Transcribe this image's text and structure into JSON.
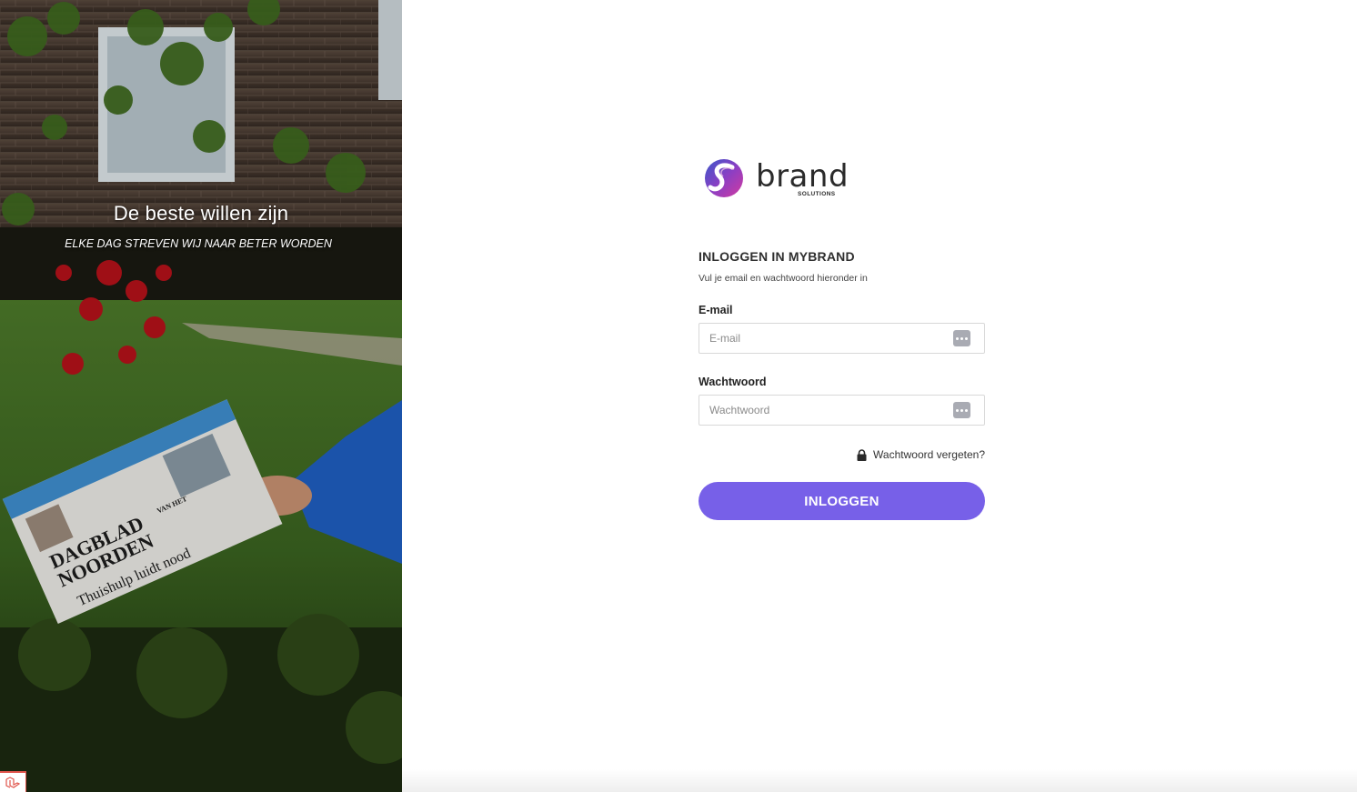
{
  "hero": {
    "title": "De beste willen zijn",
    "subtitle": "ELKE DAG STREVEN WIJ NAAR BETER WORDEN",
    "newspaper_masthead_1": "DAGBLAD",
    "newspaper_masthead_2": "NOORDEN",
    "newspaper_small": "VAN HET",
    "newspaper_headline": "Thuishulp luidt nood"
  },
  "brand": {
    "name": "brand",
    "tagline": "SOLUTIONS"
  },
  "login": {
    "title": "INLOGGEN IN MYBRAND",
    "subtitle": "Vul je email en wachtwoord hieronder in",
    "email_label": "E-mail",
    "email_placeholder": "E-mail",
    "email_value": "",
    "password_label": "Wachtwoord",
    "password_placeholder": "Wachtwoord",
    "password_value": "",
    "forgot_label": "Wachtwoord vergeten?",
    "submit_label": "INLOGGEN"
  },
  "colors": {
    "accent": "#7760e8",
    "field_icon": "#a9abb3",
    "badge_red": "#e0544b"
  }
}
